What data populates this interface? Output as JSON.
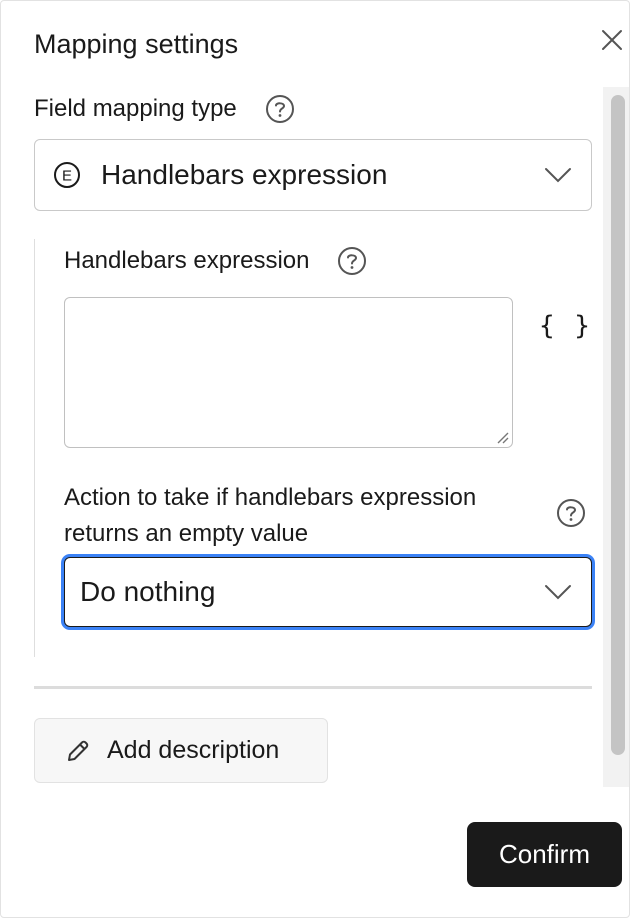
{
  "dialog": {
    "title": "Mapping settings"
  },
  "field_mapping": {
    "label": "Field mapping type",
    "selected_badge": "E",
    "selected_value": "Handlebars expression"
  },
  "expression": {
    "label": "Handlebars expression",
    "value": "",
    "braces": "{ }"
  },
  "empty_action": {
    "label": "Action to take if handlebars expression returns an empty value",
    "selected_value": "Do nothing"
  },
  "footer": {
    "add_description_label": "Add description",
    "confirm_label": "Confirm"
  },
  "colors": {
    "focus_ring": "#3b82f6",
    "primary_button": "#1a1a1a"
  },
  "icons": [
    "close-icon",
    "help-icon",
    "chevron-down-icon",
    "pencil-icon",
    "resize-grip-icon"
  ]
}
